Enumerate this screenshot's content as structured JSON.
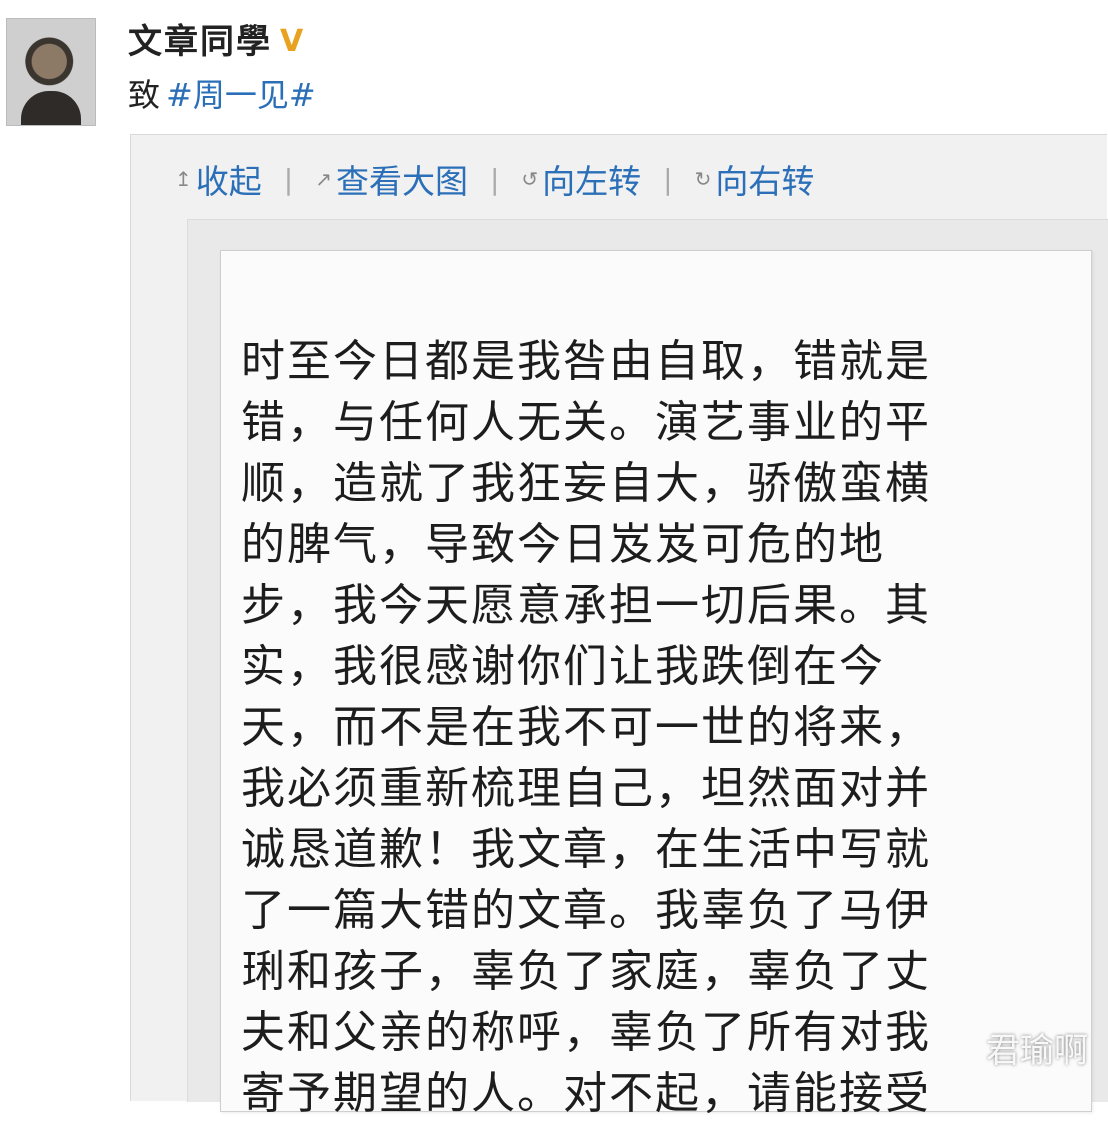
{
  "user": {
    "name": "文章同學",
    "verified_badge": "V"
  },
  "post": {
    "prefix": "致",
    "topic": "#周一见#"
  },
  "toolbar": {
    "collapse_label": "收起",
    "view_large_label": "查看大图",
    "rotate_left_label": "向左转",
    "rotate_right_label": "向右转",
    "separator": "|"
  },
  "note": {
    "lines": [
      "时至今日都是我咎由自取，错就是",
      "错，与任何人无关。演艺事业的平",
      "顺，造就了我狂妄自大，骄傲蛮横",
      "的脾气，导致今日岌岌可危的地",
      "步，我今天愿意承担一切后果。其",
      "实，我很感谢你们让我跌倒在今",
      "天，而不是在我不可一世的将来，",
      "我必须重新梳理自己，坦然面对并",
      "诚恳道歉！我文章，在生活中写就",
      "了一篇大错的文章。我辜负了马伊",
      "琍和孩子，辜负了家庭，辜负了丈",
      "夫和父亲的称呼，辜负了所有对我",
      "寄予期望的人。对不起，请能接受"
    ]
  },
  "watermark": "君瑜啊",
  "icons": {
    "collapse": "arrow-up-icon",
    "view_large": "external-link-icon",
    "rotate_left": "rotate-left-icon",
    "rotate_right": "rotate-right-icon"
  },
  "colors": {
    "link": "#2a6fb8",
    "verified": "#e8a21f",
    "text": "#222222"
  }
}
